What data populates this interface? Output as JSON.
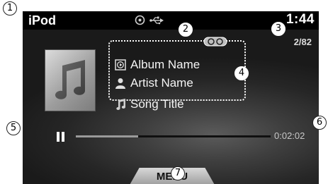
{
  "header": {
    "title": "iPod",
    "clock": "1:44"
  },
  "status_icons": [
    "disc-icon",
    "usb-icon"
  ],
  "track_counter": "2/82",
  "track": {
    "album": "Album Name",
    "artist": "Artist Name",
    "song": "Song Title"
  },
  "playback": {
    "state": "paused",
    "elapsed": "0:02:02",
    "progress_fraction": 0.32
  },
  "menu": {
    "label": "MENU"
  },
  "callouts": [
    "1",
    "2",
    "3",
    "4",
    "5",
    "6",
    "7"
  ],
  "colors": {
    "background": "#1f1f1f",
    "topbar": "#000000",
    "text": "#ffffff",
    "highlight_border": "#ffffff"
  }
}
